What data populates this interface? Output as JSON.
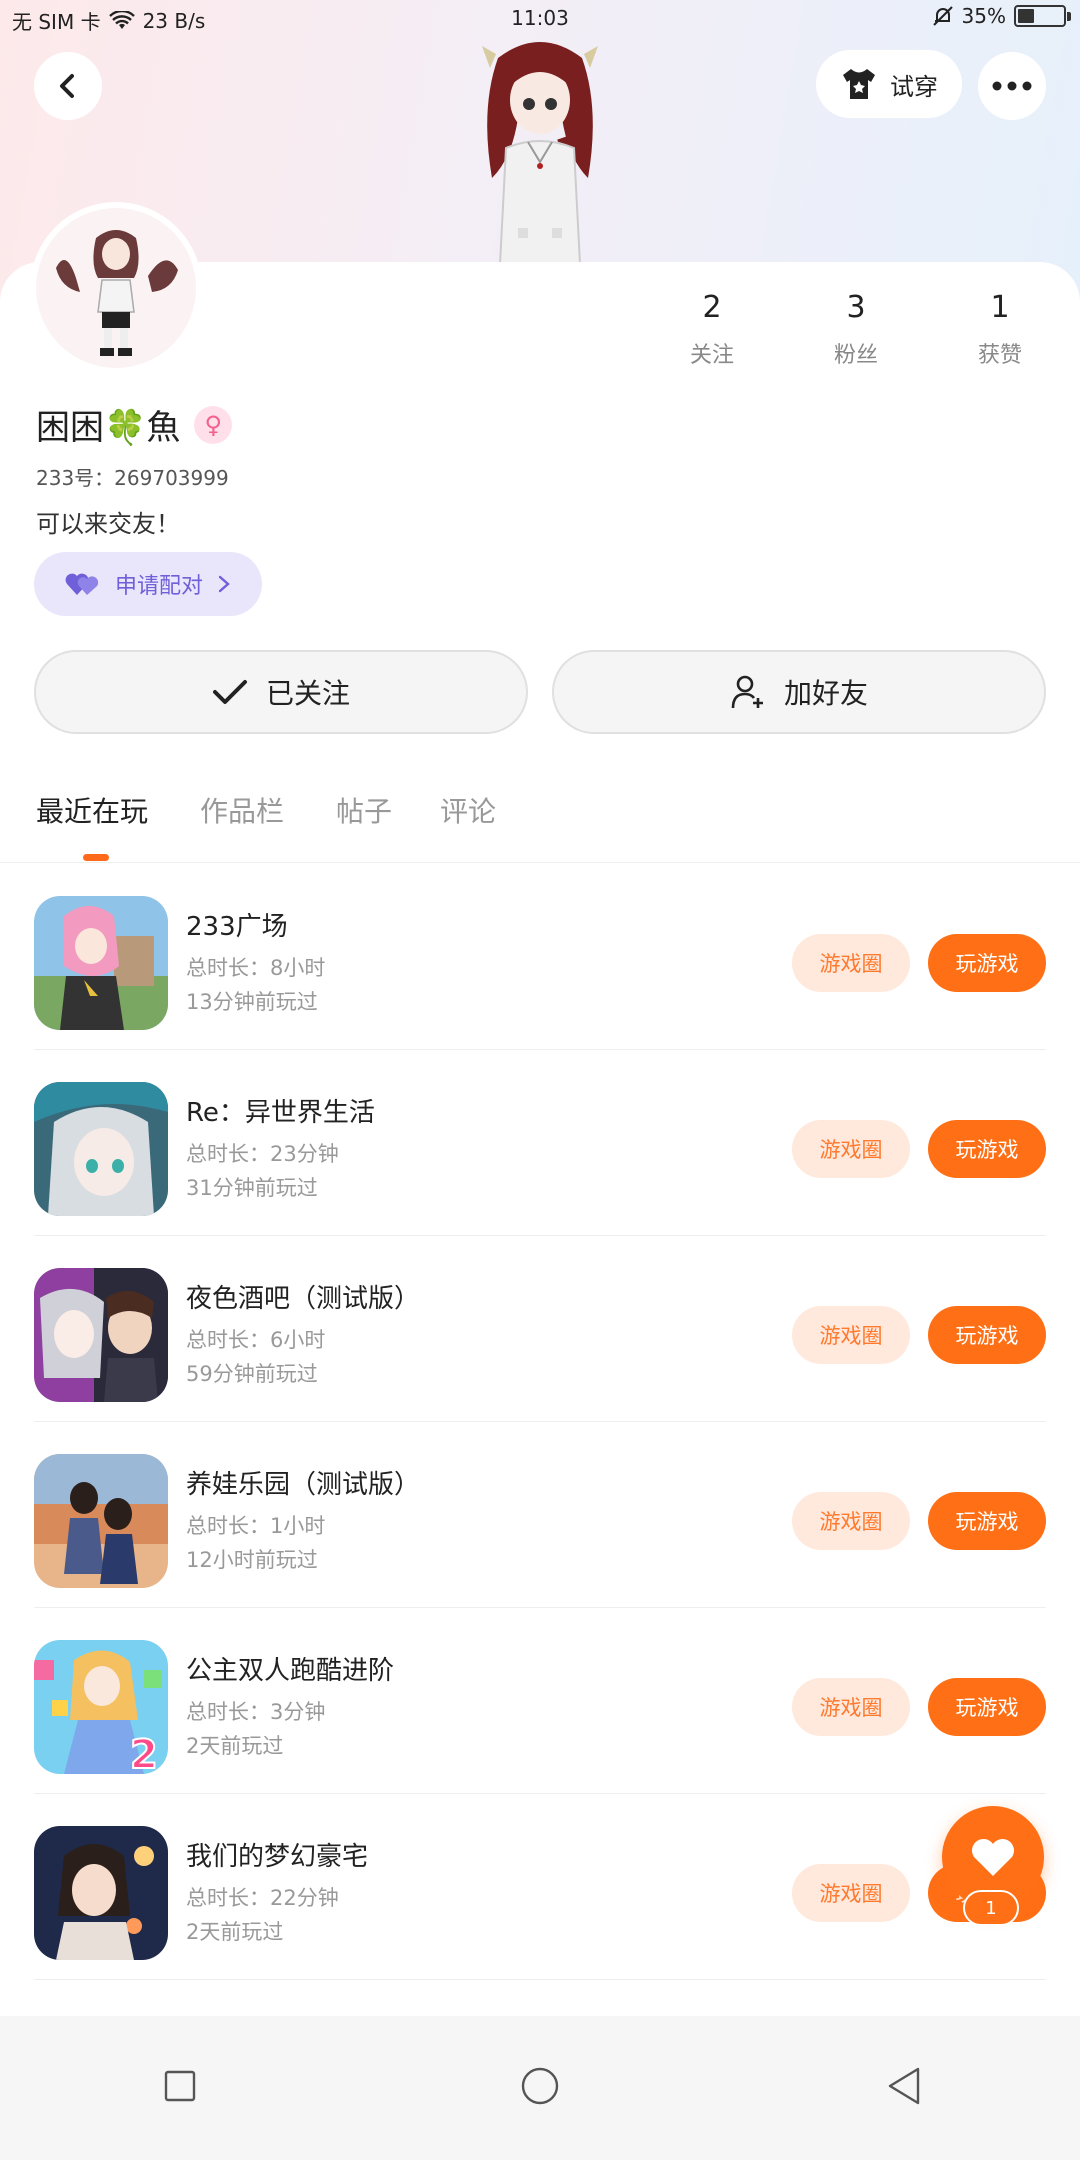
{
  "status_bar": {
    "carrier": "无 SIM 卡",
    "network_speed": "23 B/s",
    "time": "11:03",
    "battery": "35%"
  },
  "header": {
    "try_on_label": "试穿"
  },
  "profile": {
    "stats": [
      {
        "value": "2",
        "label": "关注"
      },
      {
        "value": "3",
        "label": "粉丝"
      },
      {
        "value": "1",
        "label": "获赞"
      }
    ],
    "nickname_part1": "困困",
    "nickname_emoji": "🍀",
    "nickname_part2": "魚",
    "gender_symbol": "♀",
    "uid": "233号：269703999",
    "bio": "可以来交友！",
    "pair_label": "申请配对"
  },
  "actions": {
    "followed_label": "已关注",
    "add_friend_label": "加好友"
  },
  "tabs": [
    "最近在玩",
    "作品栏",
    "帖子",
    "评论"
  ],
  "games": [
    {
      "title": "233广场",
      "duration": "总时长：8小时",
      "last_played": "13分钟前玩过",
      "circle_label": "游戏圈",
      "play_label": "玩游戏"
    },
    {
      "title": "Re：异世界生活",
      "duration": "总时长：23分钟",
      "last_played": "31分钟前玩过",
      "circle_label": "游戏圈",
      "play_label": "玩游戏"
    },
    {
      "title": "夜色酒吧（测试版）",
      "duration": "总时长：6小时",
      "last_played": "59分钟前玩过",
      "circle_label": "游戏圈",
      "play_label": "玩游戏"
    },
    {
      "title": "养娃乐园（测试版）",
      "duration": "总时长：1小时",
      "last_played": "12小时前玩过",
      "circle_label": "游戏圈",
      "play_label": "玩游戏"
    },
    {
      "title": "公主双人跑酷进阶",
      "duration": "总时长：3分钟",
      "last_played": "2天前玩过",
      "circle_label": "游戏圈",
      "play_label": "玩游戏"
    },
    {
      "title": "我们的梦幻豪宅",
      "duration": "总时长：22分钟",
      "last_played": "2天前玩过",
      "circle_label": "游戏圈",
      "play_label": "玩游戏"
    }
  ],
  "fab": {
    "count": "1"
  },
  "colors": {
    "accent": "#ff6f15",
    "accent_light": "#ffe8dc",
    "pair_bg": "#e9e6fb",
    "pair_text": "#6f5fd8"
  }
}
